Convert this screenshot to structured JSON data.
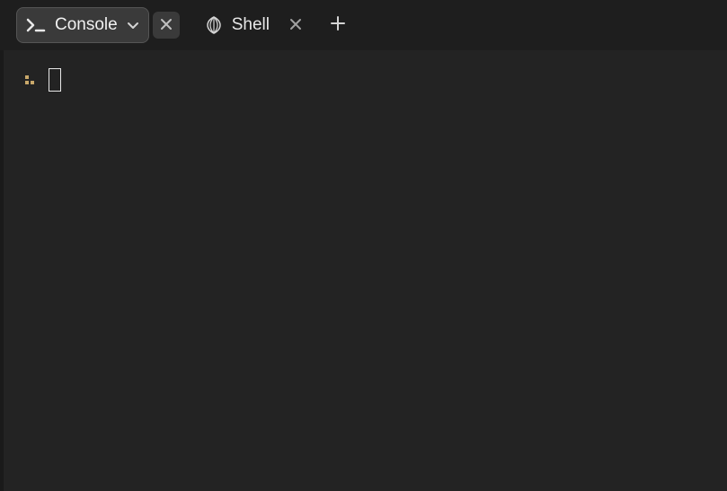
{
  "tabs": [
    {
      "label": "Console",
      "active": true,
      "icon": "console-prompt-icon",
      "has_dropdown": true
    },
    {
      "label": "Shell",
      "active": false,
      "icon": "shell-icon",
      "has_dropdown": false
    }
  ],
  "console": {
    "input_value": ""
  }
}
